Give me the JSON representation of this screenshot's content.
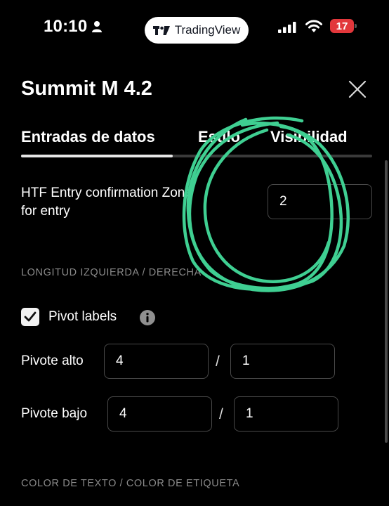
{
  "status_bar": {
    "time": "10:10",
    "app_pill_label": "TradingView",
    "battery_level": "17"
  },
  "dialog": {
    "title": "Summit M 4.2",
    "tabs": [
      {
        "label": "Entradas de datos",
        "active": true
      },
      {
        "label": "Estilo",
        "active": false
      },
      {
        "label": "Visibilidad",
        "active": false
      }
    ]
  },
  "htf_entry": {
    "label_line1": "HTF Entry confirmation Zone",
    "label_line2": "for entry",
    "value": "2"
  },
  "section_length": {
    "header": "LONGITUD IZQUIERDA / DERECHA"
  },
  "pivot_labels": {
    "label": "Pivot labels",
    "checked": true
  },
  "pivot_high": {
    "label": "Pivote alto",
    "left_value": "4",
    "separator": "/",
    "right_value": "1"
  },
  "pivot_low": {
    "label": "Pivote bajo",
    "left_value": "4",
    "separator": "/",
    "right_value": "1"
  },
  "section_color": {
    "header": "COLOR DE TEXTO / COLOR DE ETIQUETA"
  },
  "colors": {
    "background": "#000000",
    "scribble": "#3fcf92",
    "battery": "#e2373b"
  }
}
